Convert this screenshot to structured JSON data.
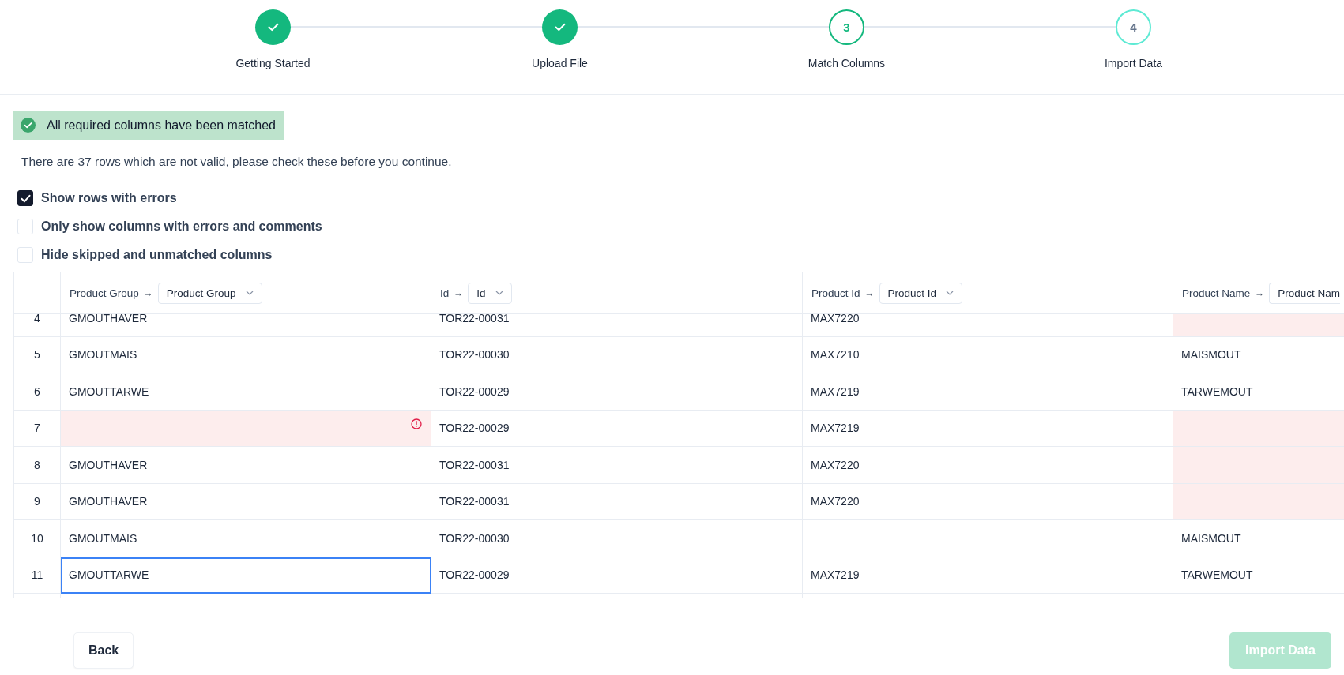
{
  "steps": [
    {
      "label": "Getting Started",
      "completed": true,
      "selected": false
    },
    {
      "label": "Upload File",
      "completed": true,
      "selected": false
    },
    {
      "label": "Match Columns",
      "number": "3",
      "completed": false,
      "selected": true
    },
    {
      "label": "Import Data",
      "number": "4",
      "completed": false,
      "selected": false
    }
  ],
  "banner": {
    "text": "All required columns have been matched"
  },
  "message": "There are 37 rows which are not valid, please check these before you continue.",
  "options": [
    {
      "label": "Show rows with errors",
      "checked": true
    },
    {
      "label": "Only show columns with errors and comments",
      "checked": false
    },
    {
      "label": "Hide skipped and unmatched columns",
      "checked": false
    }
  ],
  "table": {
    "columns": [
      {
        "source": "Product Group",
        "arrow": "→",
        "target": "Product Group"
      },
      {
        "source": "Id",
        "arrow": "→",
        "target": "Id"
      },
      {
        "source": "Product Id",
        "arrow": "→",
        "target": "Product Id"
      },
      {
        "source": "Product Name",
        "arrow": "→",
        "target": "Product Nam"
      }
    ],
    "rows": [
      {
        "number": "4",
        "cells": [
          {
            "text": "GMOUTHAVER",
            "invalid": false,
            "alert": false,
            "selected": false
          },
          {
            "text": "TOR22-00031",
            "invalid": false,
            "alert": false,
            "selected": false
          },
          {
            "text": "MAX7220",
            "invalid": false,
            "alert": false,
            "selected": false
          },
          {
            "invalid": true,
            "alert": false,
            "selected": false
          }
        ]
      },
      {
        "number": "5",
        "cells": [
          {
            "text": "GMOUTMAIS",
            "invalid": false,
            "alert": false,
            "selected": false
          },
          {
            "text": "TOR22-00030",
            "invalid": false,
            "alert": false,
            "selected": false
          },
          {
            "text": "MAX7210",
            "invalid": false,
            "alert": false,
            "selected": false
          },
          {
            "text": "MAISMOUT",
            "invalid": false,
            "alert": false,
            "selected": false
          }
        ]
      },
      {
        "number": "6",
        "cells": [
          {
            "text": "GMOUTTARWE",
            "invalid": false,
            "alert": false,
            "selected": false
          },
          {
            "text": "TOR22-00029",
            "invalid": false,
            "alert": false,
            "selected": false
          },
          {
            "text": "MAX7219",
            "invalid": false,
            "alert": false,
            "selected": false
          },
          {
            "text": "TARWEMOUT",
            "invalid": false,
            "alert": false,
            "selected": false
          }
        ]
      },
      {
        "number": "7",
        "cells": [
          {
            "invalid": true,
            "alert": true,
            "selected": false
          },
          {
            "text": "TOR22-00029",
            "invalid": false,
            "alert": false,
            "selected": false
          },
          {
            "text": "MAX7219",
            "invalid": false,
            "alert": false,
            "selected": false
          },
          {
            "invalid": true,
            "alert": false,
            "selected": false
          }
        ]
      },
      {
        "number": "8",
        "cells": [
          {
            "text": "GMOUTHAVER",
            "invalid": false,
            "alert": false,
            "selected": false
          },
          {
            "text": "TOR22-00031",
            "invalid": false,
            "alert": false,
            "selected": false
          },
          {
            "text": "MAX7220",
            "invalid": false,
            "alert": false,
            "selected": false
          },
          {
            "invalid": true,
            "alert": false,
            "selected": false
          }
        ]
      },
      {
        "number": "9",
        "cells": [
          {
            "text": "GMOUTHAVER",
            "invalid": false,
            "alert": false,
            "selected": false
          },
          {
            "text": "TOR22-00031",
            "invalid": false,
            "alert": false,
            "selected": false
          },
          {
            "text": "MAX7220",
            "invalid": false,
            "alert": false,
            "selected": false
          },
          {
            "invalid": true,
            "alert": false,
            "selected": false
          }
        ]
      },
      {
        "number": "10",
        "cells": [
          {
            "text": "GMOUTMAIS",
            "invalid": false,
            "alert": false,
            "selected": false
          },
          {
            "text": "TOR22-00030",
            "invalid": false,
            "alert": false,
            "selected": false
          },
          {
            "invalid": false,
            "alert": false,
            "selected": false
          },
          {
            "text": "MAISMOUT",
            "invalid": false,
            "alert": false,
            "selected": false
          }
        ]
      },
      {
        "number": "11",
        "cells": [
          {
            "text": "GMOUTTARWE",
            "invalid": false,
            "alert": false,
            "selected": true
          },
          {
            "text": "TOR22-00029",
            "invalid": false,
            "alert": false,
            "selected": false
          },
          {
            "text": "MAX7219",
            "invalid": false,
            "alert": false,
            "selected": false
          },
          {
            "text": "TARWEMOUT",
            "invalid": false,
            "alert": false,
            "selected": false
          }
        ]
      }
    ]
  },
  "footer": {
    "back": {
      "label": "Back",
      "disabled": false
    },
    "import": {
      "label": "Import Data",
      "disabled": true
    }
  }
}
